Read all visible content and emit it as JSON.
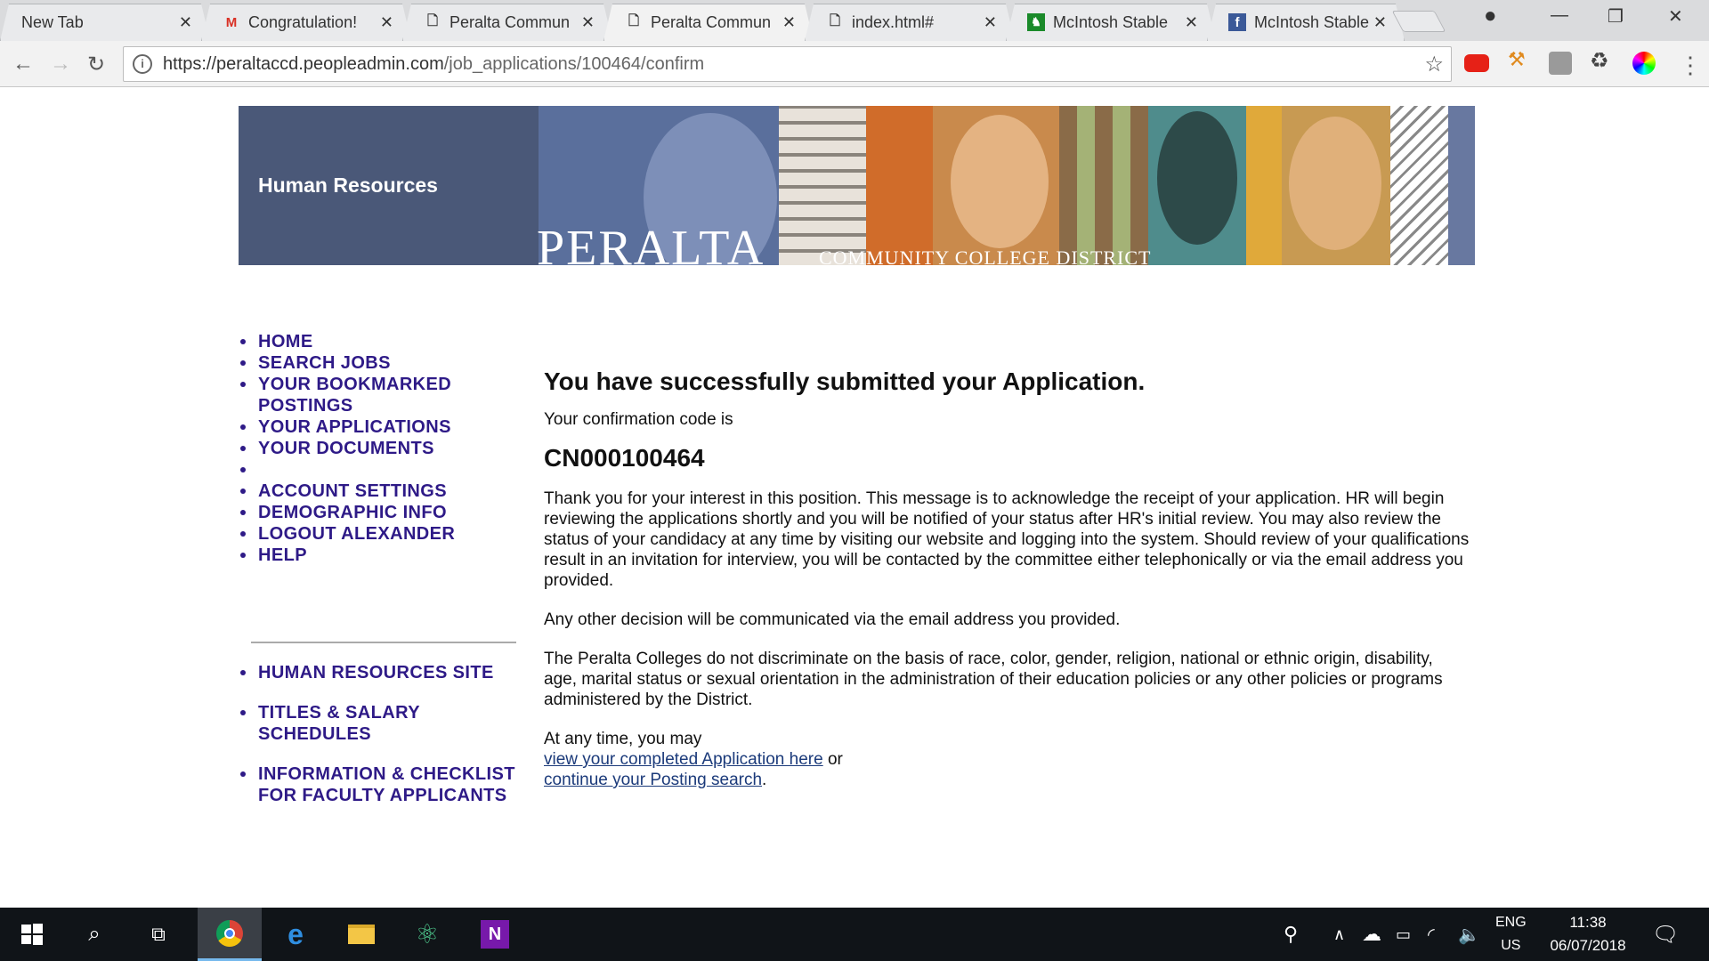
{
  "tabs": [
    {
      "label": "New Tab",
      "icon": "none"
    },
    {
      "label": "Congratulation!",
      "icon": "gmail-icon"
    },
    {
      "label": "Peralta Commun",
      "icon": "page-icon"
    },
    {
      "label": "Peralta Commun",
      "icon": "page-icon"
    },
    {
      "label": "index.html#",
      "icon": "page-icon"
    },
    {
      "label": "McIntosh Stable",
      "icon": "horse-icon"
    },
    {
      "label": "McIntosh Stable",
      "icon": "facebook-icon"
    }
  ],
  "active_tab": 3,
  "url": {
    "host": "https://peraltaccd.peopleadmin.com",
    "path": "/job_applications/100464/confirm"
  },
  "banner": {
    "title": "Human Resources",
    "logo": "PERALTA",
    "subtitle": "COMMUNITY COLLEGE DISTRICT"
  },
  "nav": {
    "main_items": [
      "HOME",
      "SEARCH JOBS",
      "YOUR BOOKMARKED POSTINGS",
      "YOUR APPLICATIONS",
      "YOUR DOCUMENTS",
      "",
      "ACCOUNT SETTINGS",
      "DEMOGRAPHIC INFO",
      "LOGOUT ALEXANDER",
      "HELP"
    ],
    "extra_items": [
      "HUMAN RESOURCES SITE",
      "TITLES & SALARY SCHEDULES",
      "INFORMATION & CHECKLIST FOR FACULTY APPLICANTS"
    ]
  },
  "content": {
    "heading": "You have successfully submitted your Application.",
    "code_label": "Your confirmation code is",
    "code": "CN000100464",
    "para1": "Thank you for your interest in this position. This message is to acknowledge the receipt of your application. HR will begin reviewing the applications shortly and you will be notified of your status after HR's initial review. You may also review the status of your candidacy at any time by visiting our website and logging into the system. Should review of your qualifications result in an invitation for interview, you will be contacted by the committee either telephonically or via the email address you provided.",
    "para2": "Any other decision will be communicated via the email address you provided.",
    "para3": "The Peralta Colleges do not discriminate on the basis of race, color, gender, religion, national or ethnic origin, disability, age, marital status or sexual orientation in the administration of their education policies or any other policies or programs administered by the District.",
    "any_time": "At any time, you may",
    "link1": "view your completed Application here",
    "or": " or",
    "link2": "continue your Posting search",
    "period": "."
  },
  "taskbar": {
    "lang_top": "ENG",
    "lang_bottom": "US",
    "time": "11:38",
    "date": "06/07/2018"
  },
  "colors": {
    "nav": "#2e1a87",
    "banner_blue": "#4a5878",
    "taskbar": "#101418"
  }
}
